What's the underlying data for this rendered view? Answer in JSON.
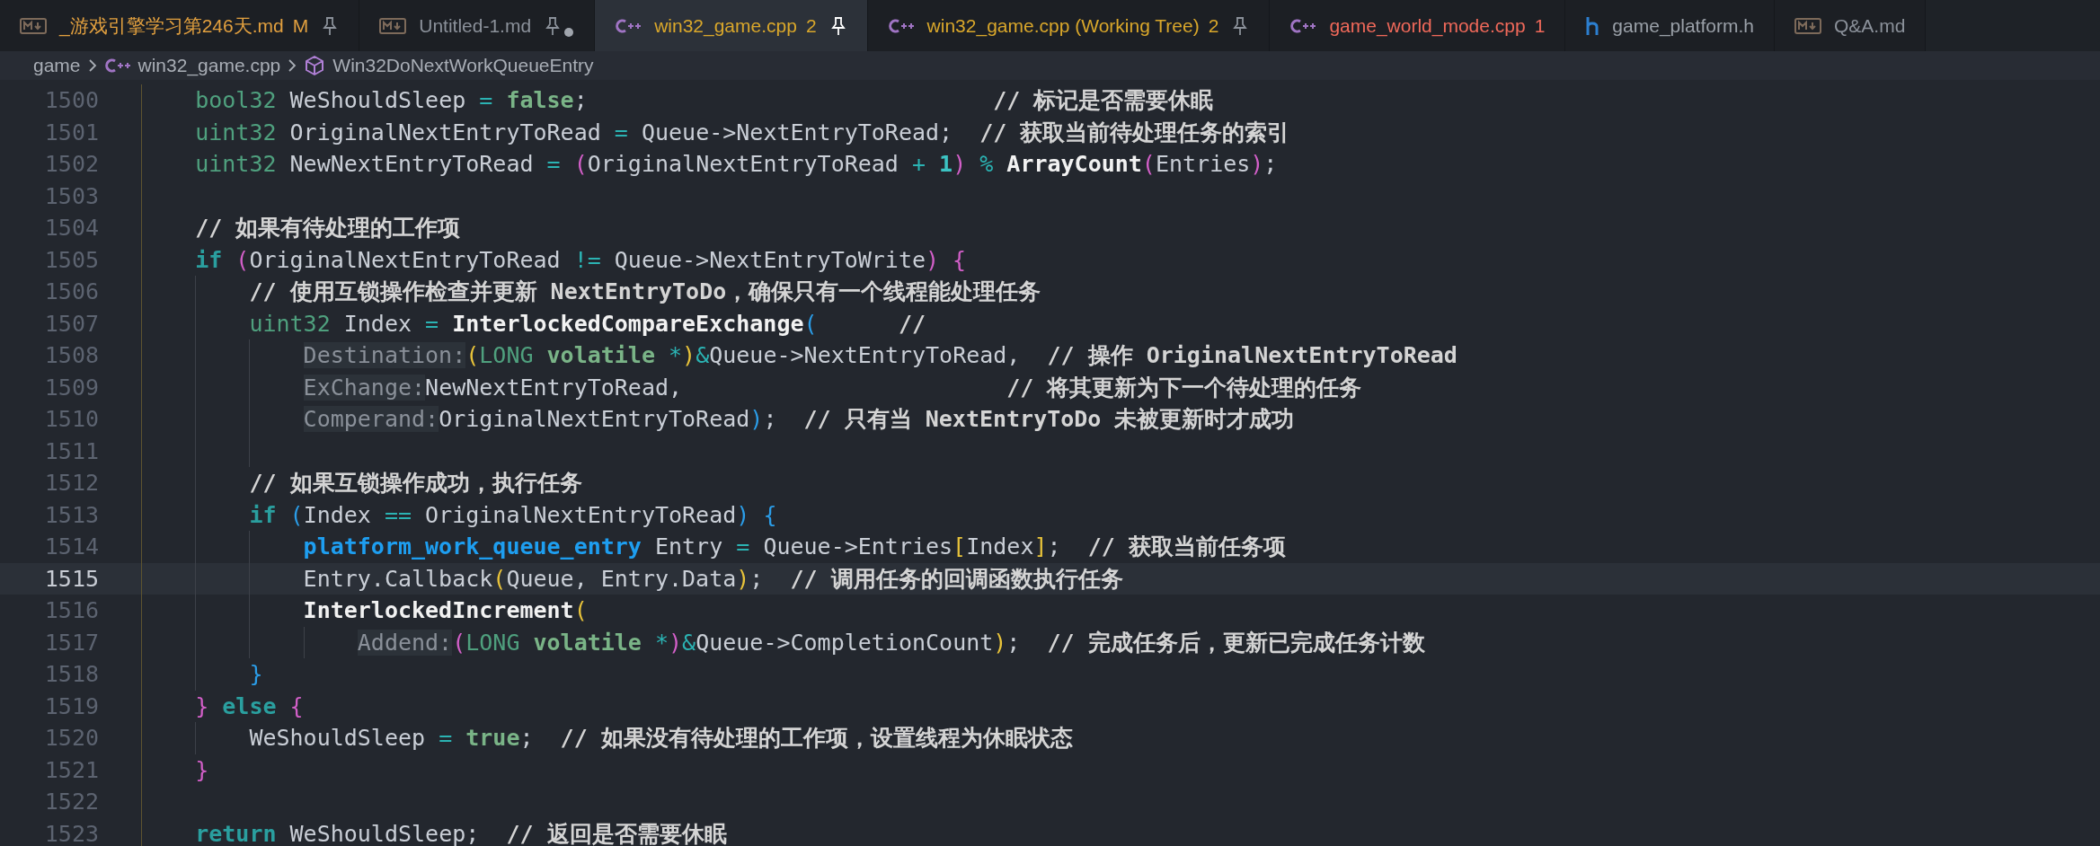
{
  "tabs": [
    {
      "label": "_游戏引擎学习第246天.md",
      "kind": "markdown",
      "status": "M",
      "pinned": true,
      "dirty": false,
      "selected": false,
      "color": "#e2a03f"
    },
    {
      "label": "Untitled-1.md",
      "kind": "markdown",
      "pinned": true,
      "dirty": true,
      "selected": false,
      "color": "#8b919a"
    },
    {
      "label": "win32_game.cpp",
      "kind": "cpp",
      "status": "2",
      "pinned": true,
      "dirty": false,
      "selected": true,
      "color": "#d9a72b"
    },
    {
      "label": "win32_game.cpp (Working Tree)",
      "kind": "cpp",
      "status": "2",
      "pinned": true,
      "dirty": false,
      "selected": false,
      "color": "#d9a72b"
    },
    {
      "label": "game_world_mode.cpp",
      "kind": "cpp",
      "status": "1",
      "pinned": false,
      "dirty": false,
      "selected": false,
      "color": "#f0695a"
    },
    {
      "label": "game_platform.h",
      "kind": "header",
      "pinned": false,
      "dirty": false,
      "selected": false,
      "color": "#9aa0a8"
    },
    {
      "label": "Q&A.md",
      "kind": "markdown",
      "pinned": false,
      "dirty": false,
      "selected": false,
      "color": "#8b919a"
    }
  ],
  "breadcrumbs": [
    {
      "label": "game",
      "kind": "folder"
    },
    {
      "label": "win32_game.cpp",
      "kind": "cpp"
    },
    {
      "label": "Win32DoNextWorkQueueEntry",
      "kind": "symbol"
    }
  ],
  "editor": {
    "lines": [
      {
        "number": "1500",
        "current": false,
        "tokens": [
          {
            "kind": "type",
            "text": "bool32"
          },
          {
            "kind": "plain",
            "text": " WeShouldSleep "
          },
          {
            "kind": "op",
            "text": "= "
          },
          {
            "kind": "literal",
            "text": "false"
          },
          {
            "kind": "plain",
            "text": ";                              "
          },
          {
            "kind": "comment",
            "text": "// 标记是否需要休眠"
          }
        ]
      },
      {
        "number": "1501",
        "current": false,
        "tokens": [
          {
            "kind": "type",
            "text": "uint32"
          },
          {
            "kind": "plain",
            "text": " OriginalNextEntryToRead "
          },
          {
            "kind": "op",
            "text": "="
          },
          {
            "kind": "plain",
            "text": " Queue->NextEntryToRead;  "
          },
          {
            "kind": "comment",
            "text": "// 获取当前待处理任务的索引"
          }
        ]
      },
      {
        "number": "1502",
        "current": false,
        "tokens": [
          {
            "kind": "type",
            "text": "uint32"
          },
          {
            "kind": "plain",
            "text": " NewNextEntryToRead "
          },
          {
            "kind": "op",
            "text": "= "
          },
          {
            "kind": "b1",
            "text": "("
          },
          {
            "kind": "plain",
            "text": "OriginalNextEntryToRead "
          },
          {
            "kind": "op",
            "text": "+ "
          },
          {
            "kind": "number",
            "text": "1"
          },
          {
            "kind": "b1",
            "text": ")"
          },
          {
            "kind": "op",
            "text": " % "
          },
          {
            "kind": "func",
            "text": "ArrayCount"
          },
          {
            "kind": "b1",
            "text": "("
          },
          {
            "kind": "plain",
            "text": "Entries"
          },
          {
            "kind": "b1",
            "text": ")"
          },
          {
            "kind": "plain",
            "text": ";"
          }
        ]
      },
      {
        "number": "1503",
        "current": false
      },
      {
        "number": "1504",
        "current": false,
        "tokens": [
          {
            "kind": "comment",
            "text": "// 如果有待处理的工作项"
          }
        ]
      },
      {
        "number": "1505",
        "current": false,
        "tokens": [
          {
            "kind": "keyword",
            "text": "if "
          },
          {
            "kind": "b1",
            "text": "("
          },
          {
            "kind": "plain",
            "text": "OriginalNextEntryToRead "
          },
          {
            "kind": "op",
            "text": "!="
          },
          {
            "kind": "plain",
            "text": " Queue->NextEntryToWrite"
          },
          {
            "kind": "b1",
            "text": ") {"
          }
        ],
        "children": [
          {
            "number": "1506",
            "current": false,
            "tokens": [
              {
                "kind": "comment",
                "text": "// 使用互锁操作检查并更新 NextEntryToDo，确保只有一个线程能处理任务"
              }
            ]
          },
          {
            "number": "1507",
            "current": false,
            "tokens": [
              {
                "kind": "type",
                "text": "uint32"
              },
              {
                "kind": "plain",
                "text": " Index "
              },
              {
                "kind": "op",
                "text": "= "
              },
              {
                "kind": "func",
                "text": "InterlockedCompareExchange"
              },
              {
                "kind": "b3",
                "text": "("
              },
              {
                "kind": "comment",
                "text": "      //"
              }
            ],
            "children": [
              {
                "number": "1508",
                "current": false,
                "tokens": [
                  {
                    "kind": "hint",
                    "text": "Destination:"
                  },
                  {
                    "kind": "b2",
                    "text": "("
                  },
                  {
                    "kind": "type",
                    "text": "LONG "
                  },
                  {
                    "kind": "literal",
                    "text": "volatile "
                  },
                  {
                    "kind": "op",
                    "text": "*"
                  },
                  {
                    "kind": "b2",
                    "text": ")"
                  },
                  {
                    "kind": "op",
                    "text": "&"
                  },
                  {
                    "kind": "plain",
                    "text": "Queue->NextEntryToRead,  "
                  },
                  {
                    "kind": "comment",
                    "text": "// 操作 OriginalNextEntryToRead"
                  }
                ]
              },
              {
                "number": "1509",
                "current": false,
                "tokens": [
                  {
                    "kind": "hint",
                    "text": "ExChange:"
                  },
                  {
                    "kind": "plain",
                    "text": "NewNextEntryToRead,                        "
                  },
                  {
                    "kind": "comment",
                    "text": "// 将其更新为下一个待处理的任务"
                  }
                ]
              },
              {
                "number": "1510",
                "current": false,
                "tokens": [
                  {
                    "kind": "hint",
                    "text": "Comperand:"
                  },
                  {
                    "kind": "plain",
                    "text": "OriginalNextEntryToRead"
                  },
                  {
                    "kind": "b3",
                    "text": ")"
                  },
                  {
                    "kind": "plain",
                    "text": ";  "
                  },
                  {
                    "kind": "comment",
                    "text": "// 只有当 NextEntryToDo 未被更新时才成功"
                  }
                ]
              },
              {
                "number": "1511",
                "current": false
              }
            ]
          },
          {
            "number": "1512",
            "current": false,
            "tokens": [
              {
                "kind": "comment",
                "text": "// 如果互锁操作成功，执行任务"
              }
            ]
          },
          {
            "number": "1513",
            "current": false,
            "tokens": [
              {
                "kind": "keyword",
                "text": "if "
              },
              {
                "kind": "b3",
                "text": "("
              },
              {
                "kind": "plain",
                "text": "Index "
              },
              {
                "kind": "op",
                "text": "=="
              },
              {
                "kind": "plain",
                "text": " OriginalNextEntryToRead"
              },
              {
                "kind": "b3",
                "text": ") {"
              }
            ],
            "children": [
              {
                "number": "1514",
                "current": false,
                "tokens": [
                  {
                    "kind": "typebold",
                    "text": "platform_work_queue_entry"
                  },
                  {
                    "kind": "plain",
                    "text": " Entry "
                  },
                  {
                    "kind": "op",
                    "text": "="
                  },
                  {
                    "kind": "plain",
                    "text": " Queue->Entries"
                  },
                  {
                    "kind": "b2",
                    "text": "["
                  },
                  {
                    "kind": "plain",
                    "text": "Index"
                  },
                  {
                    "kind": "b2",
                    "text": "]"
                  },
                  {
                    "kind": "plain",
                    "text": ";  "
                  },
                  {
                    "kind": "comment",
                    "text": "// 获取当前任务项"
                  }
                ]
              },
              {
                "number": "1515",
                "current": true,
                "tokens": [
                  {
                    "kind": "plain",
                    "text": "Entry.Callback"
                  },
                  {
                    "kind": "b2",
                    "text": "("
                  },
                  {
                    "kind": "plain",
                    "text": "Queue, Entry.Data"
                  },
                  {
                    "kind": "b2",
                    "text": ")"
                  },
                  {
                    "kind": "plain",
                    "text": ";  "
                  },
                  {
                    "kind": "comment",
                    "text": "// 调用任务的回调函数执行任务"
                  }
                ]
              },
              {
                "number": "1516",
                "current": false,
                "tokens": [
                  {
                    "kind": "func",
                    "text": "InterlockedIncrement"
                  },
                  {
                    "kind": "b2",
                    "text": "("
                  }
                ],
                "children": [
                  {
                    "number": "1517",
                    "current": false,
                    "tokens": [
                      {
                        "kind": "hint",
                        "text": "Addend:"
                      },
                      {
                        "kind": "b1",
                        "text": "("
                      },
                      {
                        "kind": "type",
                        "text": "LONG "
                      },
                      {
                        "kind": "literal",
                        "text": "volatile "
                      },
                      {
                        "kind": "op",
                        "text": "*"
                      },
                      {
                        "kind": "b1",
                        "text": ")"
                      },
                      {
                        "kind": "op",
                        "text": "&"
                      },
                      {
                        "kind": "plain",
                        "text": "Queue->CompletionCount"
                      },
                      {
                        "kind": "b2",
                        "text": ")"
                      },
                      {
                        "kind": "plain",
                        "text": ";  "
                      },
                      {
                        "kind": "comment",
                        "text": "// 完成任务后，更新已完成任务计数"
                      }
                    ]
                  }
                ]
              }
            ]
          },
          {
            "number": "1518",
            "current": false,
            "tokens": [
              {
                "kind": "b3",
                "text": "}"
              }
            ]
          }
        ]
      },
      {
        "number": "1519",
        "current": false,
        "tokens": [
          {
            "kind": "b1",
            "text": "} "
          },
          {
            "kind": "keyword",
            "text": "else "
          },
          {
            "kind": "b1",
            "text": "{"
          }
        ],
        "children": [
          {
            "number": "1520",
            "current": false,
            "tokens": [
              {
                "kind": "plain",
                "text": "WeShouldSleep "
              },
              {
                "kind": "op",
                "text": "= "
              },
              {
                "kind": "literal",
                "text": "true"
              },
              {
                "kind": "plain",
                "text": ";  "
              },
              {
                "kind": "comment",
                "text": "// 如果没有待处理的工作项，设置线程为休眠状态"
              }
            ]
          }
        ]
      },
      {
        "number": "1521",
        "current": false,
        "tokens": [
          {
            "kind": "b1",
            "text": "}"
          }
        ]
      },
      {
        "number": "1522",
        "current": false
      },
      {
        "number": "1523",
        "current": false,
        "tokens": [
          {
            "kind": "keyword",
            "text": "return"
          },
          {
            "kind": "plain",
            "text": " WeShouldSleep;  "
          },
          {
            "kind": "comment",
            "text": "// 返回是否需要休眠"
          }
        ]
      }
    ]
  }
}
